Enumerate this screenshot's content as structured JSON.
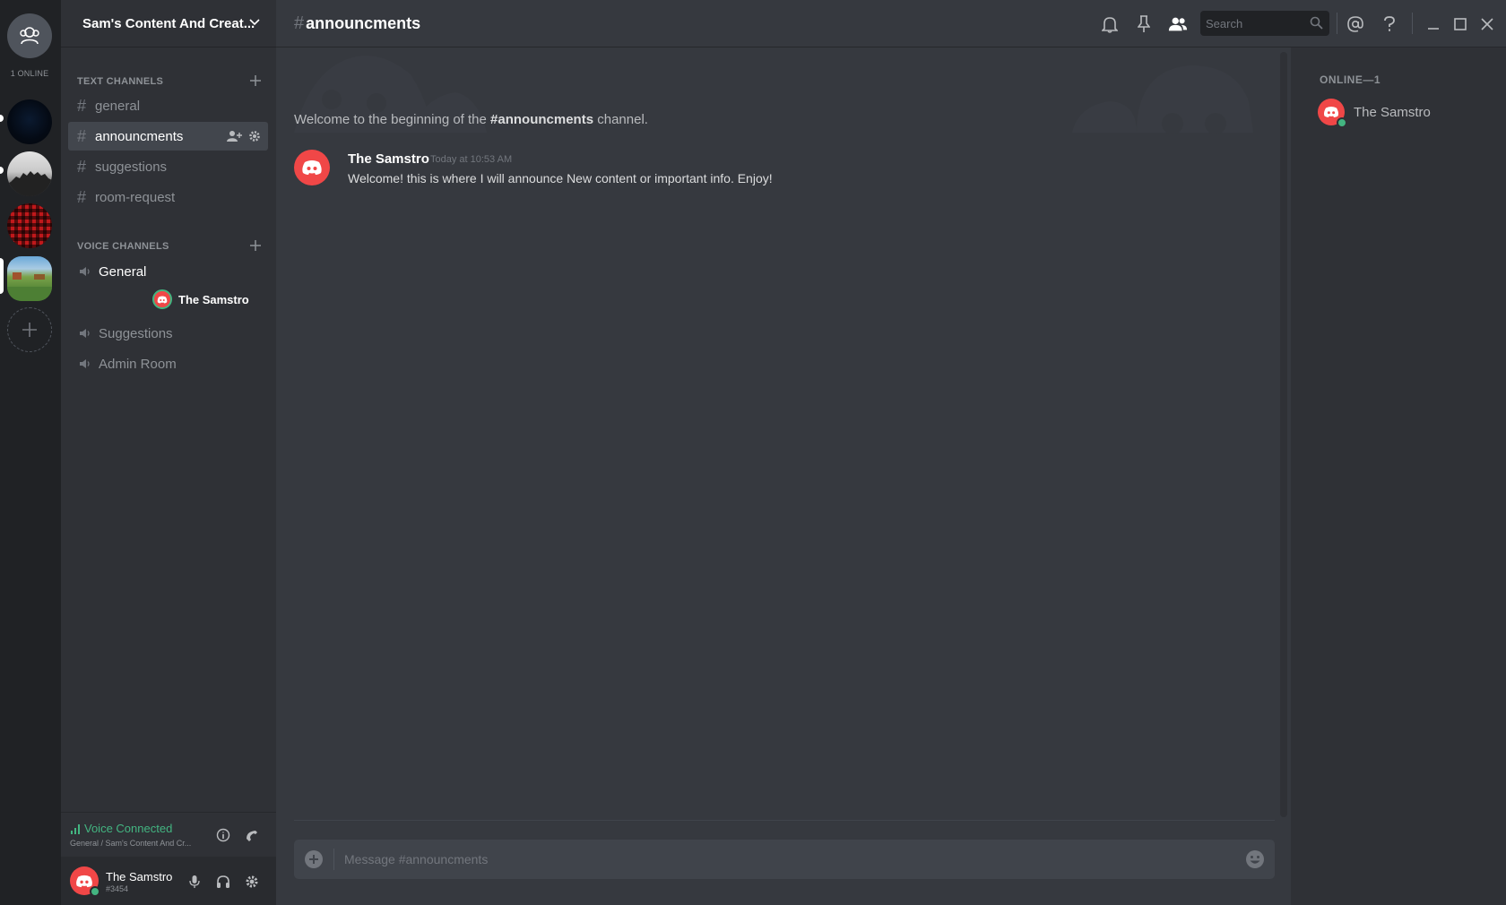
{
  "colors": {
    "online": "#43b581",
    "brand_red": "#f04747",
    "accent": "#7289da"
  },
  "guilds": {
    "online_count": "1 ONLINE",
    "items": [
      {
        "name": "friends-home",
        "icon": "friends-icon"
      },
      {
        "name": "dark-server"
      },
      {
        "name": "silhouette-server"
      },
      {
        "name": "plaid-server"
      },
      {
        "name": "sams-content-server",
        "selected": true
      },
      {
        "name": "add-server",
        "icon": "plus-icon"
      }
    ]
  },
  "server": {
    "name": "Sam's Content And Creat..."
  },
  "text_channels": {
    "label": "TEXT CHANNELS",
    "items": [
      {
        "name": "general"
      },
      {
        "name": "announcments",
        "selected": true
      },
      {
        "name": "suggestions"
      },
      {
        "name": "room-request"
      }
    ]
  },
  "voice_channels": {
    "label": "VOICE CHANNELS",
    "items": [
      {
        "name": "General",
        "active": true,
        "users": [
          {
            "name": "The Samstro"
          }
        ]
      },
      {
        "name": "Suggestions"
      },
      {
        "name": "Admin Room"
      }
    ]
  },
  "voice_panel": {
    "status": "Voice Connected",
    "location": "General / Sam's Content And Cr..."
  },
  "user_panel": {
    "username": "The Samstro",
    "tag": "#3454"
  },
  "header": {
    "channel_name": "announcments",
    "search_placeholder": "Search",
    "icons": [
      "bell-icon",
      "pin-icon",
      "members-icon",
      "mention-icon",
      "help-icon",
      "minimize-icon",
      "maximize-icon",
      "close-icon"
    ]
  },
  "chat": {
    "welcome_prefix": "Welcome to the beginning of the ",
    "welcome_channel": "#announcments",
    "welcome_suffix": " channel.",
    "messages": [
      {
        "author": "The Samstro",
        "timestamp": "Today at 10:53 AM",
        "content": "Welcome! this is where I will announce New content or important info. Enjoy!"
      }
    ]
  },
  "composer": {
    "placeholder": "Message #announcments"
  },
  "members": {
    "header": "ONLINE—1",
    "items": [
      {
        "name": "The Samstro",
        "status": "online"
      }
    ]
  }
}
